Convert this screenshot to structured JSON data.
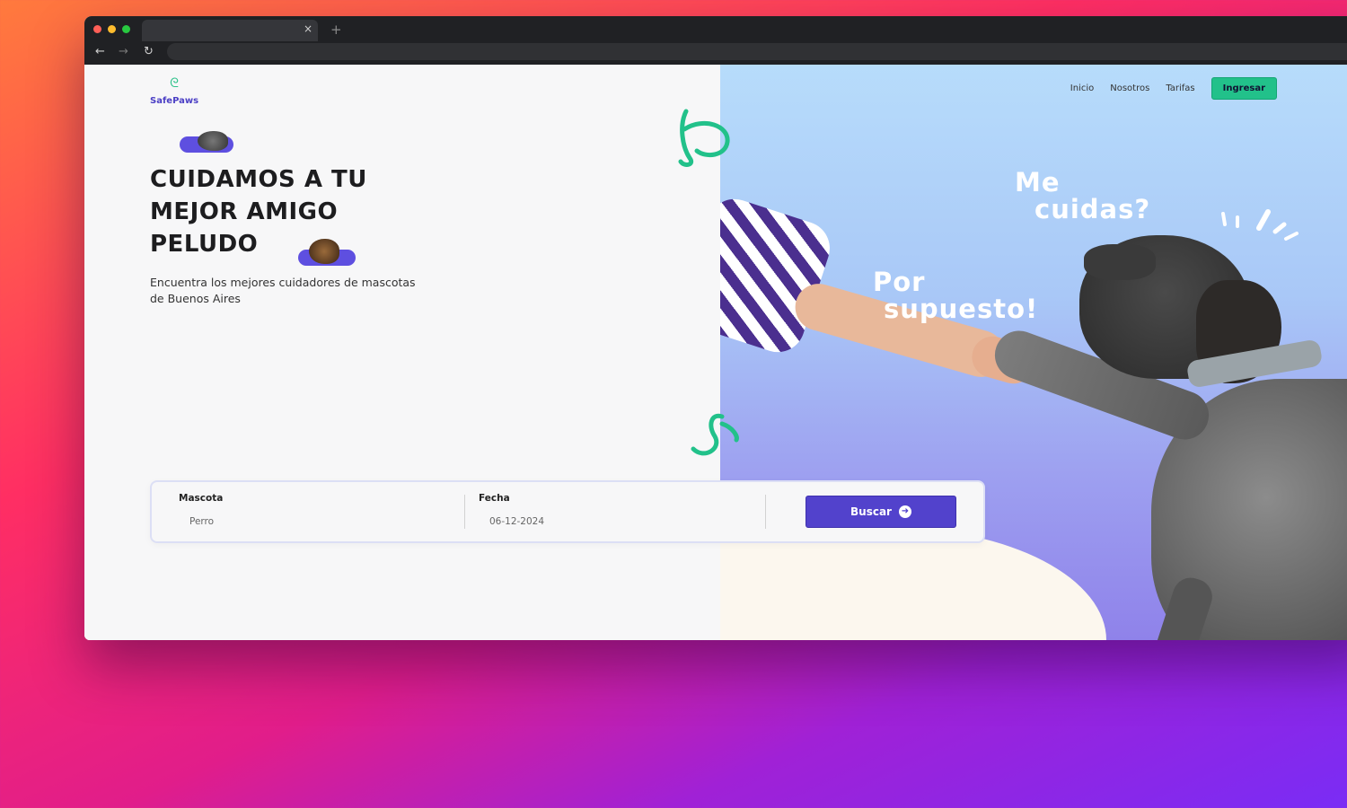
{
  "browser": {
    "tab_close_glyph": "×",
    "new_tab_glyph": "+",
    "back_glyph": "←",
    "forward_glyph": "→",
    "reload_glyph": "↻"
  },
  "site": {
    "logo_text": "SafePaws",
    "nav": {
      "items": [
        "Inicio",
        "Nosotros",
        "Tarifas"
      ],
      "login_label": "Ingresar"
    },
    "hero": {
      "headline_lines": [
        "CUIDAMOS A TU",
        "MEJOR AMIGO",
        "PELUDO"
      ],
      "subtitle": "Encuentra los mejores cuidadores de mascotas de Buenos Aires",
      "dog_callout": [
        "Me",
        "cuidas?"
      ],
      "human_callout": [
        "Por",
        "supuesto!"
      ]
    },
    "search": {
      "pet_label": "Mascota",
      "pet_value": "Perro",
      "date_label": "Fecha",
      "date_value": "06-12-2024",
      "button_label": "Buscar",
      "button_icon": "arrow-right-circle-icon"
    }
  },
  "colors": {
    "brand_primary": "#5242cc",
    "brand_green": "#22c18a",
    "hero_bg_top": "#b7dcfb",
    "hero_bg_bottom": "#8f82ea"
  }
}
